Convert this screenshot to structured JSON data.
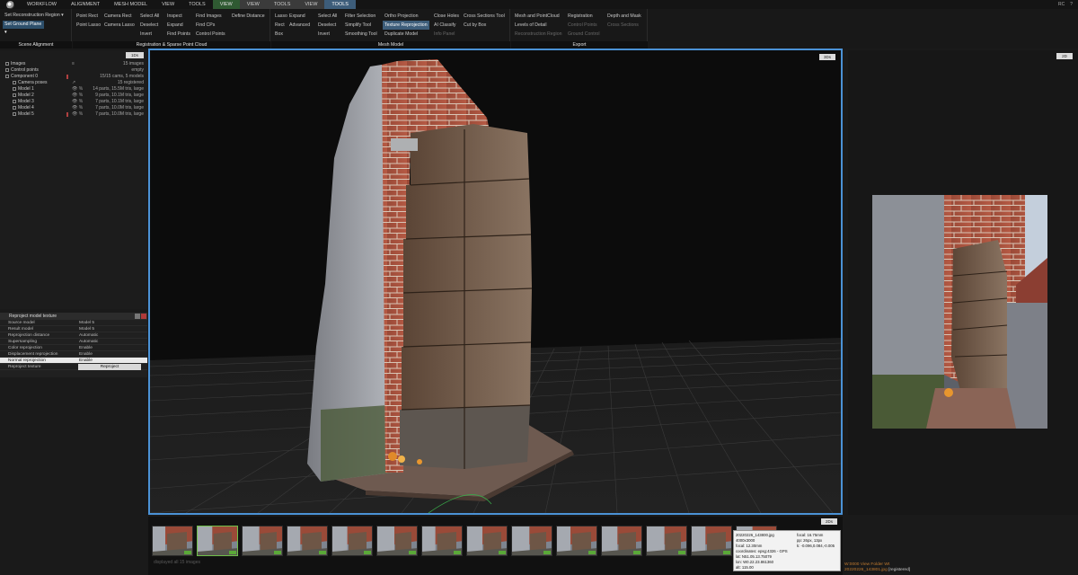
{
  "menu": {
    "tabs": [
      "WORKFLOW",
      "ALIGNMENT",
      "MESH MODEL",
      "VIEW",
      "TOOLS",
      "VIEW",
      "VIEW",
      "TOOLS",
      "VIEW",
      "TOOLS"
    ],
    "window_controls": [
      "RC",
      "?"
    ]
  },
  "ribbon": {
    "scene_alignment": {
      "label": "Scene Alignment",
      "set_region": "Set Reconstruction Region",
      "set_ground": "Set Ground Plane"
    },
    "registration": {
      "label": "Registration & Sparse Point Cloud",
      "cols": [
        [
          "Point Rect",
          "Point Lasso"
        ],
        [
          "Camera Rect",
          "Camera Lasso"
        ],
        [
          "Select All",
          "Deselect",
          "Invert"
        ],
        [
          "Inspect",
          "Expand",
          "Find Points"
        ],
        [
          "Find Images",
          "Find CPs",
          "Control Points"
        ],
        [
          "Define Distance"
        ]
      ]
    },
    "mesh_model": {
      "label": "Mesh Model",
      "cols": [
        [
          "Lasso",
          "Rect",
          "Box"
        ],
        [
          "Expand",
          "Advanced"
        ],
        [
          "Select All",
          "Deselect",
          "Invert"
        ],
        [
          "Filter Selection",
          "Simplify Tool",
          "Smoothing Tool"
        ],
        [
          "Ortho Projection",
          "Texture Reprojection",
          "Duplicate Model"
        ],
        [
          "Close Holes",
          "AI Classify",
          "Info Panel"
        ],
        [
          "Cross Sections Tool",
          "Cut by Box"
        ]
      ]
    },
    "export": {
      "label": "Export",
      "cols": [
        [
          "Mesh and PointCloud",
          "Levels of Detail",
          "Reconstruction Region"
        ],
        [
          "Registration",
          "Control Points",
          "Ground Control"
        ],
        [
          "Depth and Mask",
          "Cross Sections"
        ]
      ]
    }
  },
  "tree": {
    "button": "1Ds",
    "rows": [
      {
        "name": "Images",
        "sym": "≡",
        "value": "15 images"
      },
      {
        "name": "Control points",
        "sym": "",
        "value": "empty"
      },
      {
        "name": "Component 0",
        "sym": "",
        "value": "15/15 cams, 5 models"
      },
      {
        "name": "Camera poses",
        "sym": "↗",
        "value": "15 registered"
      },
      {
        "name": "Model 1",
        "sym": "👁 %",
        "value": "14 parts, 15.5M tris, large"
      },
      {
        "name": "Model 2",
        "sym": "👁 %",
        "value": "9 parts, 10.1M tris, large"
      },
      {
        "name": "Model 3",
        "sym": "👁 %",
        "value": "7 parts, 10.1M tris, large"
      },
      {
        "name": "Model 4",
        "sym": "👁 %",
        "value": "7 parts, 10.0M tris, large"
      },
      {
        "name": "Model 5",
        "sym": "👁 %",
        "value": "7 parts, 10.0M tris, large"
      }
    ]
  },
  "props": {
    "title": "Reproject model texture",
    "rows": [
      {
        "key": "Source model",
        "value": "Model 5"
      },
      {
        "key": "Result model",
        "value": "Model 5"
      },
      {
        "key": "Reprojection distance",
        "value": "Automatic"
      },
      {
        "key": "Supersampling",
        "value": "Automatic"
      },
      {
        "key": "Color reprojection",
        "value": "Enable"
      },
      {
        "key": "Displacement reprojection",
        "value": "Enable"
      },
      {
        "key": "Normal reprojection",
        "value": "Enable"
      }
    ],
    "action_key": "Reproject texture",
    "action_button": "Reproject"
  },
  "viewport": {
    "button": "3Ds"
  },
  "view2d": {
    "button": "2D"
  },
  "filmstrip": {
    "button": "2Ds",
    "caption": "displayed all 15 images",
    "selected_index": 1,
    "count": 15
  },
  "tooltip": {
    "left_lines": [
      "20220226_143800.jpg",
      "4000x3000",
      "focal: 12.30mm",
      "coordinates: epsg:4326 - GPS",
      "lat: N51.05.13.75079",
      "lon: W0.22.23.861360",
      "alt: 115.00"
    ],
    "right_lines": [
      "focal: 16.75mm",
      "pp: 26px, 13px",
      "k: -0.096,0.084,-0.005"
    ]
  },
  "status": {
    "line1": "W:0000 View Folder Wt",
    "line2_file": "20220226_143801.jpg",
    "line2_state": "[registered]"
  },
  "colors": {
    "accent_blue": "#4b92d6",
    "highlight_blue": "#3d5d7a",
    "view_green": "#2f5a32",
    "badge_green": "#5aa838"
  }
}
